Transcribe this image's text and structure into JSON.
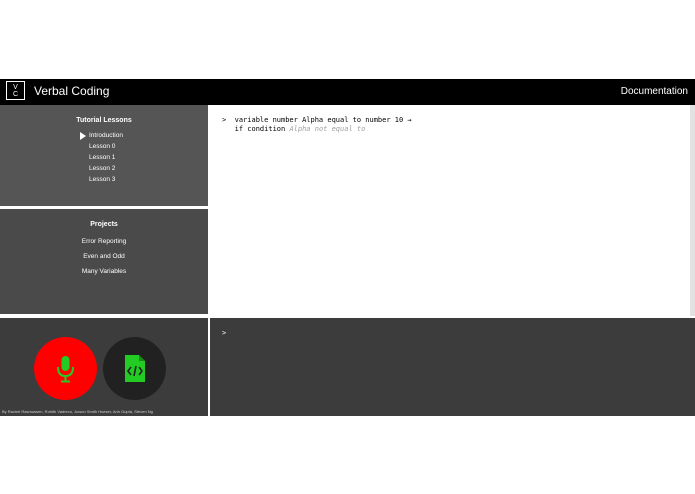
{
  "header": {
    "logo_top": "V",
    "logo_bottom": "C",
    "title": "Verbal Coding",
    "documentation_label": "Documentation"
  },
  "lessons": {
    "title": "Tutorial Lessons",
    "items": [
      {
        "label": "Introduction",
        "active": true
      },
      {
        "label": "Lesson 0"
      },
      {
        "label": "Lesson 1"
      },
      {
        "label": "Lesson 2"
      },
      {
        "label": "Lesson 3"
      }
    ]
  },
  "projects": {
    "title": "Projects",
    "items": [
      {
        "label": "Error Reporting"
      },
      {
        "label": "Even and Odd"
      },
      {
        "label": "Many Variables"
      }
    ]
  },
  "editor": {
    "line1": ">  variable number Alpha equal to number 10 →",
    "line2_prefix": "   if condition ",
    "line2_ghost": "Alpha not equal to"
  },
  "controls": {
    "mic_icon": "microphone-icon",
    "code_icon": "code-file-icon",
    "mic_color": "#ff0000",
    "code_button_color": "#212121",
    "icon_color": "#22cc22",
    "credits": "By Rachel Rasmussen, Rohith Vadrevu, Juwon Smith Hueser, Arin Gupta, Steven Ng"
  },
  "terminal": {
    "prompt": ">"
  }
}
